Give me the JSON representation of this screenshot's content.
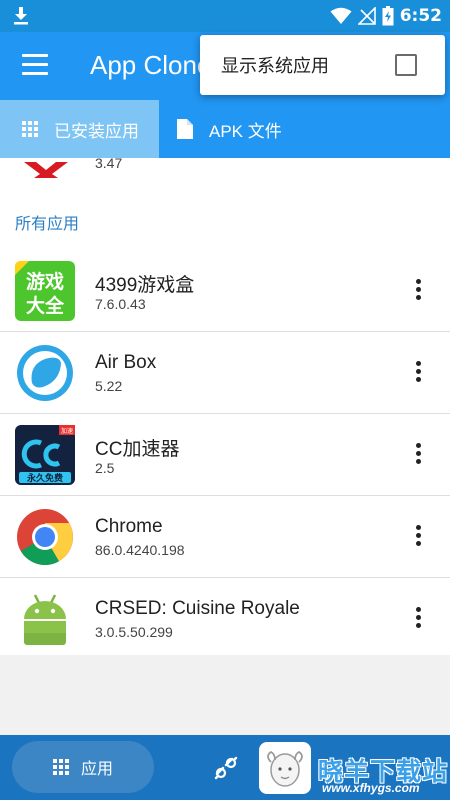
{
  "status_bar": {
    "time": "6:52"
  },
  "app_bar": {
    "title": "App Clone"
  },
  "popup": {
    "label": "显示系统应用",
    "checked": false
  },
  "tabs": [
    {
      "label": "已安装应用",
      "active": true
    },
    {
      "label": "APK 文件",
      "active": false
    }
  ],
  "partial_app": {
    "version": "3.47"
  },
  "section_header": "所有应用",
  "apps": [
    {
      "name": "4399游戏盒",
      "version": "7.6.0.43",
      "icon": "game-box-icon"
    },
    {
      "name": "Air Box",
      "version": "5.22",
      "icon": "air-box-icon"
    },
    {
      "name": "CC加速器",
      "version": "2.5",
      "icon": "cc-accelerator-icon"
    },
    {
      "name": "Chrome",
      "version": "86.0.4240.198",
      "icon": "chrome-icon"
    },
    {
      "name": "CRSED: Cuisine Royale",
      "version": "3.0.5.50.299",
      "icon": "android-icon"
    }
  ],
  "game_box_icon_text": [
    "游戏",
    "大全"
  ],
  "cc_icon_text": {
    "badge": "加速",
    "bottom": "永久免费"
  },
  "bottom_bar": {
    "apps_label": "应用"
  },
  "watermark": {
    "text": "晓羊下载站",
    "url": "www.xfhygs.com"
  },
  "colors": {
    "primary": "#2196f3",
    "status_bar": "#1a8fd9",
    "bottom_bar": "#1b74c0",
    "active_tab": "#7ec4f4",
    "section_header": "#2b7fc4"
  }
}
